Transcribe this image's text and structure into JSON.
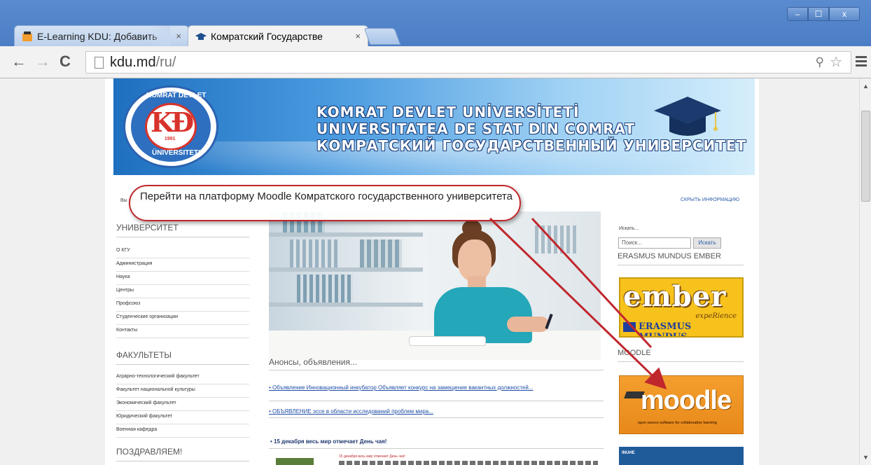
{
  "window": {
    "minimize": "–",
    "maximize": "☐",
    "close": "x"
  },
  "tabs": [
    {
      "title": "E-Learning KDU: Добавить",
      "close": "×"
    },
    {
      "title": "Комратский Государстве",
      "close": "×"
    }
  ],
  "toolbar": {
    "url_host": "kdu.md",
    "url_path": "/ru/"
  },
  "banner": {
    "line1": "KOMRAT DEVLET UNİVERSİTETİ",
    "line2": "UNIVERSITATEA DE STAT DIN COMRAT",
    "line3": "КОМРАТСКИЙ ГОСУДАРСТВЕННЫЙ УНИВЕРСИТЕТ",
    "logo_top": "KOMRAT DEVLET",
    "logo_bottom": "ÜNIVERSITETI",
    "logo_year": "1991"
  },
  "breadcrumb": "Вы здесь: Главная",
  "hide_info": "СКРЫТЬ ИНФОРМАЦИЮ",
  "sidebar": {
    "university_heading": "УНИВЕРСИТЕТ",
    "university_items": [
      "О КГУ",
      "Администрация",
      "Наука",
      "Центры",
      "Профсоюз",
      "Студенческие организации",
      "Контакты"
    ],
    "faculties_heading": "ФАКУЛЬТЕТЫ",
    "faculty_items": [
      "Аграрно-технологический факультет",
      "Факультет национальной культуры",
      "Экономический факультет",
      "Юридический факультет",
      "Военная кафедра"
    ],
    "congrats_heading": "ПОЗДРАВЛЯЕМ!"
  },
  "main": {
    "announcements_heading": "Анонсы, объявления...",
    "news": [
      "• Объявление Инновационный инкубатор Объявляет конкурс на замещение вакантных должностей...",
      "• ОБЪЯВЛЕНИЕ эссе в области исследований проблем мира..."
    ],
    "tea_heading": "• 15 декабря весь мир отмечает День чая!",
    "tea_sub": "15 декабря весь мир отмечает День чая!"
  },
  "right": {
    "search_label": "Искать...",
    "search_placeholder": "Поиск...",
    "search_button": "Искать",
    "erasmus_heading": "ERASMUS MUNDUS EMBER",
    "ember_word": "ember",
    "ember_exp": "expeRience",
    "ember_erasmus": "ERASMUS MUNDUS",
    "moodle_heading": "MOODLE",
    "moodle_word": "moodle",
    "moodle_tag": "open source software for collaborative learning",
    "bottom_box": "INUHE"
  },
  "callout": "Перейти на платформу Moodle Комратского государственного университета",
  "colors": {
    "callout_border": "#c0272d",
    "link": "#1f4ea6",
    "moodle_orange": "#f39e2e",
    "ember_yellow": "#f7c21c"
  }
}
